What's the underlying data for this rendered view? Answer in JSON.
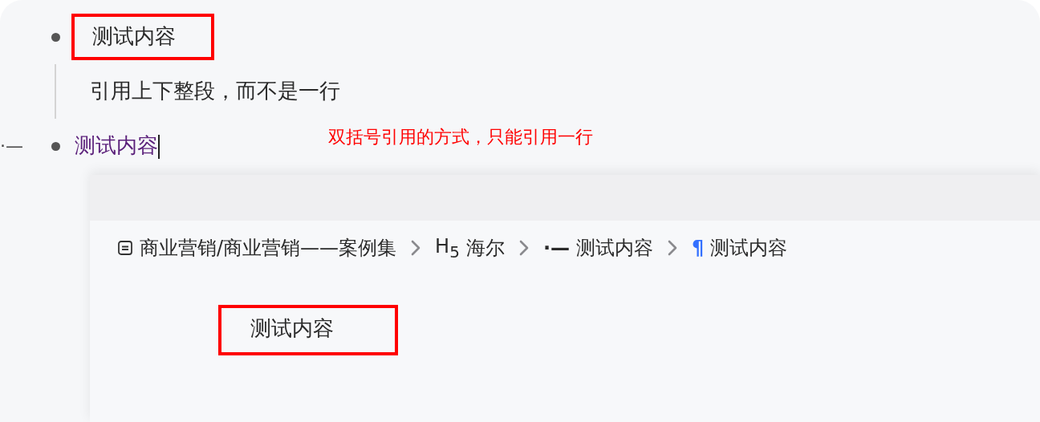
{
  "outline": [
    {
      "kind": "bullet",
      "text": "测试内容",
      "highlighted": true
    },
    {
      "kind": "quote",
      "text": "引用上下整段，而不是一行"
    },
    {
      "kind": "bullet",
      "text": "测试内容",
      "handle": "·—",
      "linked": true,
      "cursor": true,
      "note": "双括号引用的方式，只能引用一行"
    }
  ],
  "preview": {
    "breadcrumb": [
      {
        "kind": "document",
        "text": "商业营销/商业营销——案例集"
      },
      {
        "kind": "heading",
        "marker": "H$_{5}$",
        "text": "海尔"
      },
      {
        "kind": "list",
        "marker": "·—",
        "text": "测试内容"
      },
      {
        "kind": "paragraph",
        "marker": "¶",
        "text": "测试内容"
      }
    ],
    "content": {
      "text": "测试内容",
      "highlighted": true
    }
  }
}
